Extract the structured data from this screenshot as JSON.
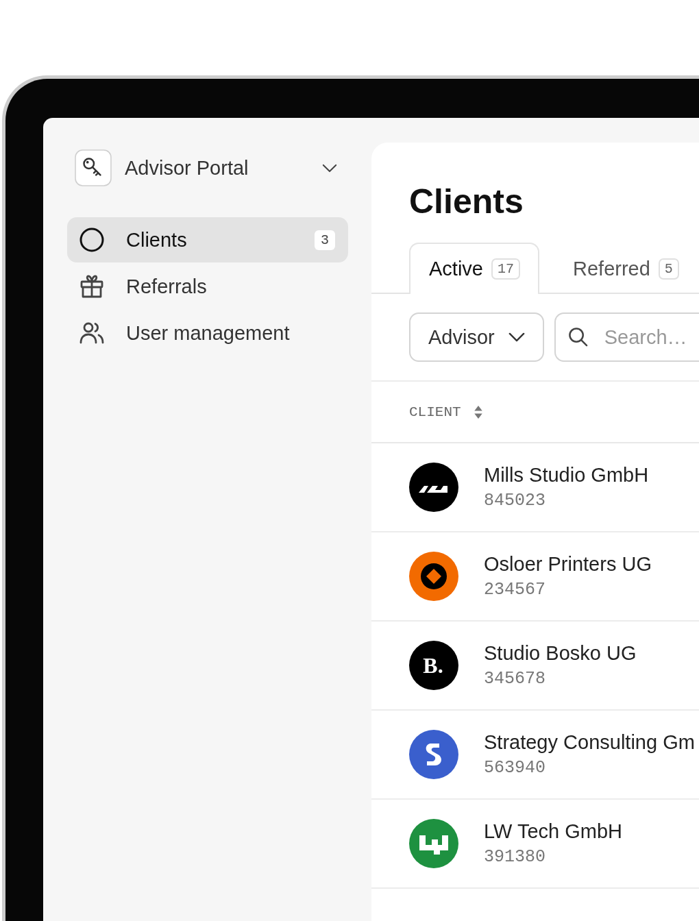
{
  "sidebar": {
    "workspace": {
      "name": "Advisor Portal"
    },
    "items": [
      {
        "label": "Clients",
        "kind": "circle",
        "count": "3",
        "selected": true
      },
      {
        "label": "Referrals",
        "kind": "gift",
        "selected": false
      },
      {
        "label": "User management",
        "kind": "users",
        "selected": false
      }
    ]
  },
  "main": {
    "title": "Clients",
    "tabs": [
      {
        "label": "Active",
        "count": "17",
        "selected": true
      },
      {
        "label": "Referred",
        "count": "5",
        "selected": false
      }
    ],
    "filter": {
      "label": "Advisor"
    },
    "search": {
      "placeholder": "Search…"
    },
    "table": {
      "columns": [
        "CLIENT"
      ],
      "rows": [
        {
          "name": "Mills Studio GmbH",
          "number": "845023",
          "kind": "steps",
          "color": "#000000"
        },
        {
          "name": "Osloer Printers UG",
          "number": "234567",
          "kind": "diamond",
          "color": "#f26a00"
        },
        {
          "name": "Studio Bosko UG",
          "number": "345678",
          "kind": "letter",
          "logo_text": "B.",
          "color": "#000000"
        },
        {
          "name": "Strategy Consulting Gm",
          "number": "563940",
          "kind": "swirl",
          "color": "#3a5fcd"
        },
        {
          "name": "LW Tech GmbH",
          "number": "391380",
          "kind": "blocks",
          "color": "#1e9140"
        }
      ]
    }
  }
}
